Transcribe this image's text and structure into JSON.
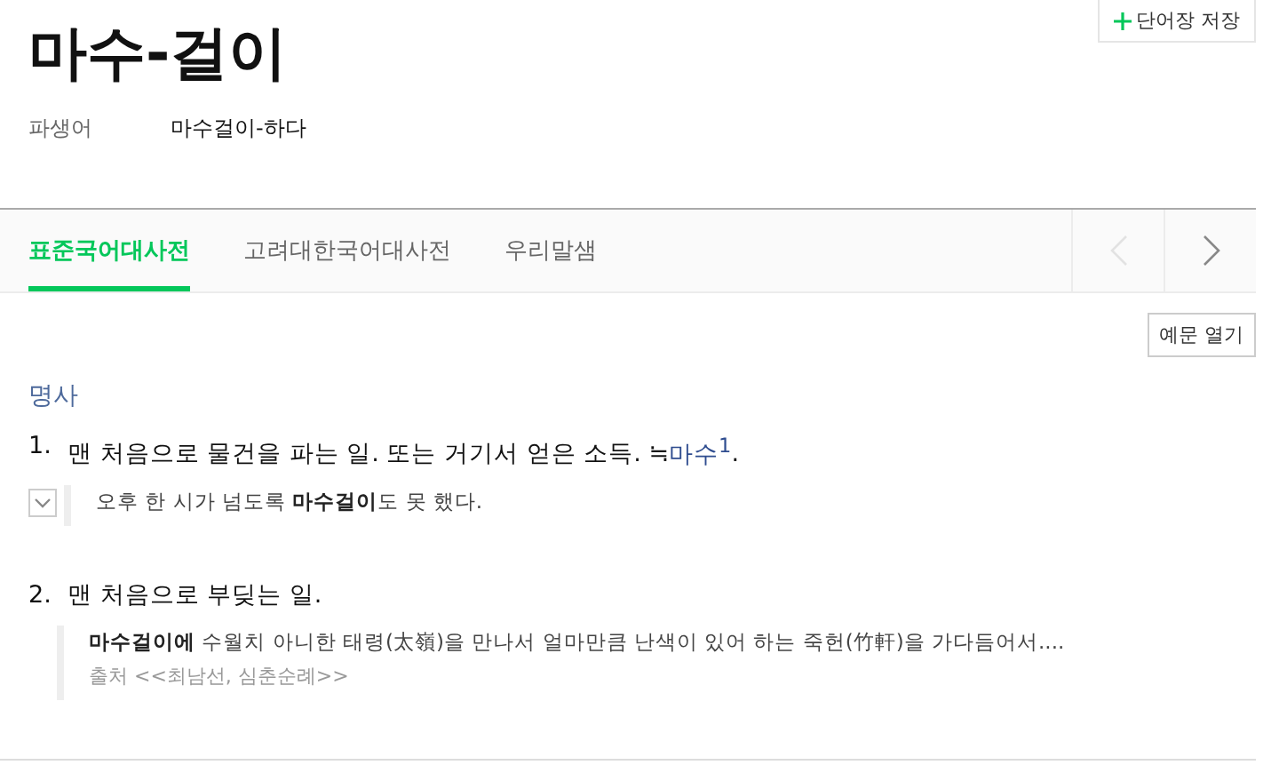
{
  "save_button": {
    "label": "단어장 저장"
  },
  "headword": "마수-걸이",
  "derivative": {
    "label": "파생어",
    "value": "마수걸이-하다"
  },
  "tabs": [
    {
      "label": "표준국어대사전",
      "selected": true
    },
    {
      "label": "고려대한국어대사전",
      "selected": false
    },
    {
      "label": "우리말샘",
      "selected": false
    }
  ],
  "tab_nav": {
    "prev_disabled": true,
    "next_disabled": false
  },
  "examples_button": {
    "label": "예문 열기"
  },
  "part_of_speech": "명사",
  "senses": [
    {
      "number": "1.",
      "text": "맨 처음으로 물건을 파는 일. 또는 거기서 얻은 소득.",
      "synonym_mark": "≒",
      "synonym": "마수$^{1}$",
      "end": ".",
      "examples": [
        {
          "text": "오후 한 시가 넘도록 **마수걸이**도 못 했다.",
          "toggle": true
        }
      ]
    },
    {
      "number": "2.",
      "text": "맨 처음으로 부딪는 일.",
      "examples": [
        {
          "text": "**마수걸이에** 수월치 아니한 태령(太嶺)을 만나서 얼마만큼 난색이 있어 하는 죽헌(竹軒)을 가다듬어서....",
          "toggle": false,
          "source": "출처 <<최남선, 심춘순례>>"
        }
      ]
    }
  ]
}
